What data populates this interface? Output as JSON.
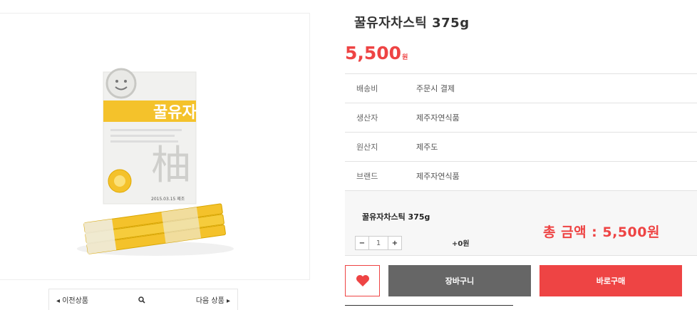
{
  "product": {
    "title": "꿀유자차스틱 375g",
    "price_num": "5,500",
    "price_unit": "원",
    "package_label": "꿀유자",
    "package_hanja": "柚",
    "package_date": "2015.03.15  제조"
  },
  "info_rows": [
    {
      "key": "배송비",
      "value": "주문시 결제"
    },
    {
      "key": "생산자",
      "value": "제주자연식품"
    },
    {
      "key": "원산지",
      "value": "제주도"
    },
    {
      "key": "브랜드",
      "value": "제주자연식품"
    }
  ],
  "buy": {
    "option_name": "꿀유자차스틱 375g",
    "minus": "−",
    "qty": "1",
    "plus": "+",
    "plus_price": "+0원",
    "total": "총 금액 : 5,500원"
  },
  "actions": {
    "cart": "장바구니",
    "buy_now": "바로구매"
  },
  "pager": {
    "prev": "◂ 이전상품",
    "next": "다음 상품 ▸"
  },
  "colors": {
    "accent": "#ee4444",
    "cart_bg": "#666666"
  },
  "icons": {
    "wish": "heart-icon",
    "zoom": "magnifier-icon"
  }
}
